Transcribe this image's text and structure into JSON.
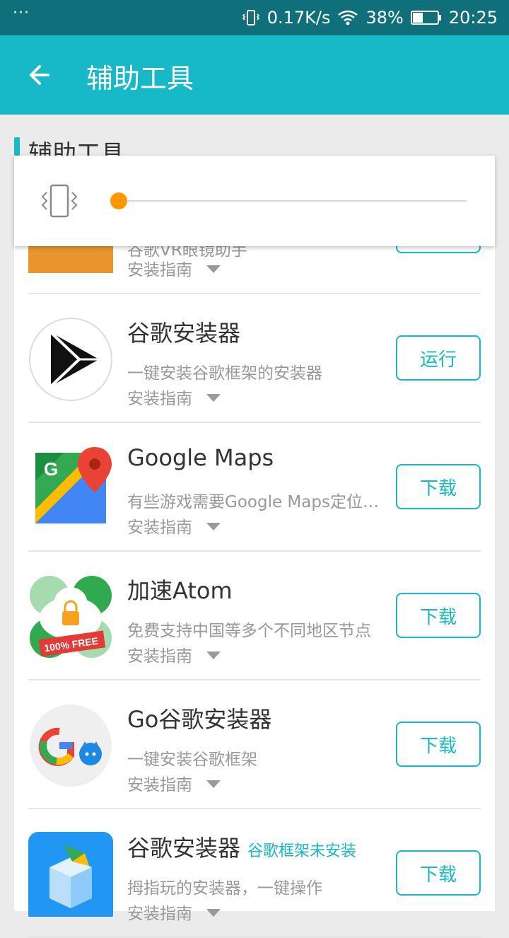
{
  "status": {
    "notif_dots": "···",
    "net_speed": "0.17K/s",
    "battery": "38%",
    "time": "20:25"
  },
  "appbar": {
    "title": "辅助工具"
  },
  "section": {
    "title": "辅助工具"
  },
  "volume_popup": {
    "level": 0.0,
    "accent": "#ff9800"
  },
  "items": [
    {
      "name": "",
      "tag": "",
      "desc": "谷歌VR眼镜助手",
      "guide": "安装指南",
      "button": ""
    },
    {
      "name": "谷歌安装器",
      "tag": "",
      "desc": "一键安装谷歌框架的安装器",
      "guide": "安装指南",
      "button": "运行"
    },
    {
      "name": "Google Maps",
      "tag": "",
      "desc": "有些游戏需要Google Maps定位支持",
      "guide": "安装指南",
      "button": "下载"
    },
    {
      "name": "加速Atom",
      "tag": "",
      "desc": "免费支持中国等多个不同地区节点",
      "guide": "安装指南",
      "button": "下载"
    },
    {
      "name": "Go谷歌安装器",
      "tag": "",
      "desc": "一键安装谷歌框架",
      "guide": "安装指南",
      "button": "下载"
    },
    {
      "name": "谷歌安装器",
      "tag": "谷歌框架未安装",
      "desc": "拇指玩的安装器，一键操作",
      "guide": "安装指南",
      "button": "下载"
    }
  ],
  "icons": {
    "atom_badge": "100% FREE"
  },
  "colors": {
    "primary": "#17b8c8",
    "statusbar": "#0f6f7a"
  }
}
